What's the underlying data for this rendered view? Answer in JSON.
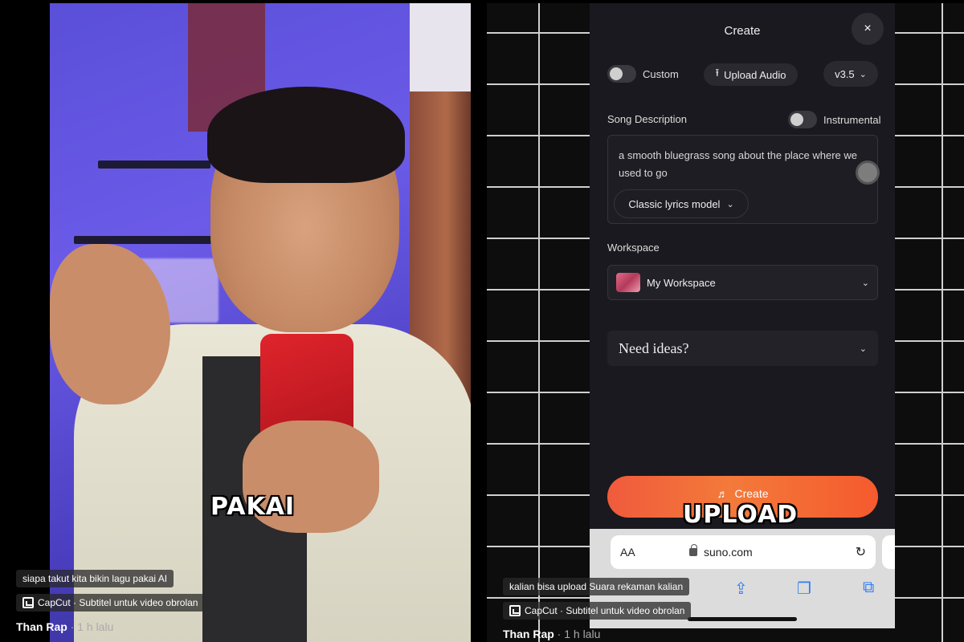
{
  "left_video": {
    "caption_word": "PAKAI",
    "title_text": "siapa takut kita bikin lagu pakai AI",
    "capcut_text": "CapCut · Subtitel untuk video obrolan",
    "author": "Than Rap",
    "time": " · 1 h lalu"
  },
  "right_video": {
    "caption_word": "UPLOAD",
    "title_text": "kalian bisa upload Suara rekaman kalian",
    "capcut_text": "CapCut · Subtitel untuk video obrolan",
    "author": "Than Rap",
    "time": " · 1 h lalu"
  },
  "suno": {
    "title": "Create",
    "close_icon": "×",
    "custom_label": "Custom",
    "upload_label": "Upload Audio",
    "upload_icon": "⭱",
    "version": "v3.5",
    "song_description_label": "Song Description",
    "instrumental_label": "Instrumental",
    "description_text": "a smooth bluegrass song about the place where we used to go",
    "lyrics_model": "Classic lyrics model",
    "workspace_label": "Workspace",
    "workspace_value": "My Workspace",
    "ideas_label": "Need ideas?",
    "create_button": "Create",
    "create_icon": "♬"
  },
  "browser": {
    "aa": "AA",
    "url": "suno.com",
    "reload_icon": "↻"
  }
}
